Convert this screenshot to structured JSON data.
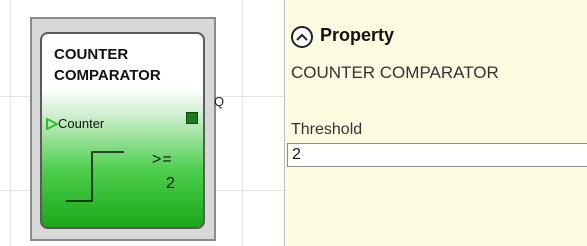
{
  "block": {
    "title_line1": "COUNTER",
    "title_line2": "COMPARATOR",
    "input_port_label": "Counter",
    "output_port_label": "Q",
    "operator": ">=",
    "threshold_display": "2"
  },
  "property_panel": {
    "header": "Property",
    "component_name": "COUNTER COMPARATOR",
    "fields": [
      {
        "label": "Threshold",
        "value": "2"
      }
    ]
  },
  "icons": {
    "collapse": "chevron-up-circle-icon",
    "input_port": "triangle-right-icon",
    "step_function": "step-waveform-icon"
  },
  "colors": {
    "panel_background": "#fdfbe0",
    "block_gradient_bottom": "#18a818",
    "output_port": "#1d7a1d",
    "input_arrow": "#2fbf2f"
  }
}
